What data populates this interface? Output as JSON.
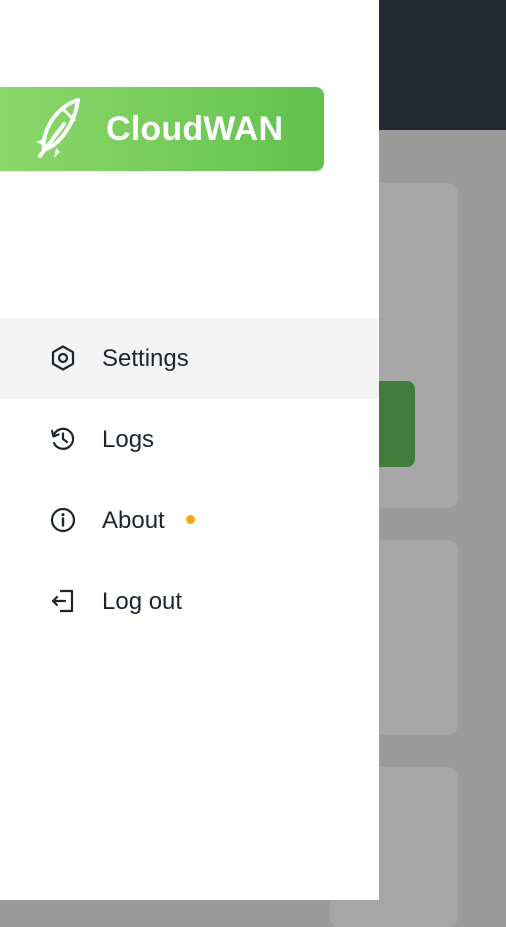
{
  "brand": {
    "name": "CloudWAN",
    "colors": {
      "gradient_start": "#8dd86a",
      "gradient_end": "#63c24f",
      "text": "#ffffff"
    }
  },
  "menu": {
    "items": [
      {
        "label": "Settings",
        "icon": "settings-hexagon-icon",
        "active": true
      },
      {
        "label": "Logs",
        "icon": "history-clock-icon",
        "active": false
      },
      {
        "label": "About",
        "icon": "info-circle-icon",
        "active": false,
        "badge_color": "#f3a81c"
      },
      {
        "label": "Log out",
        "icon": "logout-icon",
        "active": false
      }
    ]
  },
  "colors": {
    "drawer_bg": "#ffffff",
    "overlay_header": "#232833",
    "overlay_bg": "#9b9b9b",
    "overlay_button": "#427e3b",
    "text": "#1e2530"
  }
}
